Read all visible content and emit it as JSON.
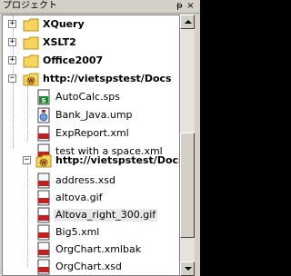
{
  "panel": {
    "title": "プロジェクト",
    "pin_glyph": "ᵽ",
    "close_glyph": "×"
  },
  "colors": {
    "folder": "#f5d55c",
    "folder_dark": "#b8901a",
    "web_folder": "#e8a040",
    "sps": "#1e8a2c",
    "umlfile": "#6e9edc",
    "xmlbadge": "#c02020",
    "xsdbadge": "#c02020",
    "gifbadge": "#c02020"
  },
  "tree": {
    "folders": [
      {
        "label": "XQuery",
        "icon": "folder-icon",
        "expander": "+"
      },
      {
        "label": "XSLT2",
        "icon": "folder-icon",
        "expander": "+"
      },
      {
        "label": "Office2007",
        "icon": "folder-icon",
        "expander": "+"
      }
    ],
    "web_folders": [
      {
        "label": "http://vietspstest/Docs",
        "icon": "web-folder-icon",
        "expander": "−",
        "files": [
          {
            "label": "AutoCalc.sps",
            "icon": "sps-file-icon",
            "badge": ""
          },
          {
            "label": "Bank_Java.ump",
            "icon": "umodel-file-icon",
            "badge": ""
          },
          {
            "label": "ExpReport.xml",
            "icon": "xml-file-icon",
            "badge": "XML"
          },
          {
            "label": "test with a space.xml",
            "icon": "xml-file-icon",
            "badge": "XML"
          }
        ]
      },
      {
        "label": "http://vietspstest/Docs",
        "icon": "web-folder-icon",
        "expander": "−",
        "files": [
          {
            "label": "address.xsd",
            "icon": "xsd-file-icon",
            "badge": "XSD"
          },
          {
            "label": "altova.gif",
            "icon": "gif-file-icon",
            "badge": "GIF"
          },
          {
            "label": "Altova_right_300.gif",
            "icon": "gif-file-icon",
            "badge": "GIF",
            "selected": true
          },
          {
            "label": "Big5.xml",
            "icon": "xml-file-icon",
            "badge": "XML"
          },
          {
            "label": "OrgChart.xmlbak",
            "icon": "xml-file-icon",
            "badge": "XML"
          },
          {
            "label": "OrgChart.xsd",
            "icon": "xsd-file-icon",
            "badge": "XSD"
          }
        ]
      }
    ]
  }
}
